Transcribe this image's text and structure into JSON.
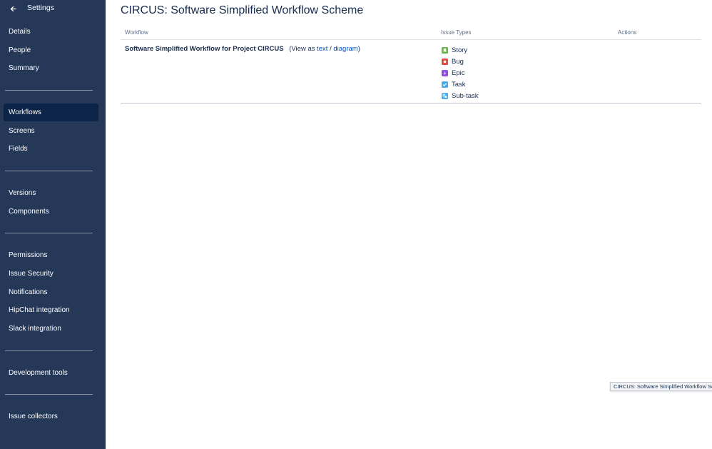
{
  "sidebar": {
    "title": "Settings",
    "back_icon": "arrow-left-icon",
    "groups": [
      [
        "Details",
        "People",
        "Summary"
      ],
      [
        "Workflows",
        "Screens",
        "Fields"
      ],
      [
        "Versions",
        "Components"
      ],
      [
        "Permissions",
        "Issue Security",
        "Notifications",
        "HipChat integration",
        "Slack integration"
      ],
      [
        "Development tools"
      ],
      [
        "Issue collectors"
      ]
    ],
    "active_item": "Workflows"
  },
  "page": {
    "title": "CIRCUS: Software Simplified Workflow Scheme"
  },
  "table": {
    "headers": {
      "workflow": "Workflow",
      "issue_types": "Issue Types",
      "actions": "Actions"
    },
    "row": {
      "workflow_name": "Software Simplified Workflow for Project CIRCUS",
      "view_prefix": "(View as",
      "text_link": "text",
      "separator": "/",
      "diagram_link": "diagram",
      "view_suffix": ")",
      "issue_types": [
        {
          "label": "Story",
          "icon": "story-icon",
          "color": "#63ba3c"
        },
        {
          "label": "Bug",
          "icon": "bug-icon",
          "color": "#e5493a"
        },
        {
          "label": "Epic",
          "icon": "epic-icon",
          "color": "#904ee2"
        },
        {
          "label": "Task",
          "icon": "task-icon",
          "color": "#4bade8"
        },
        {
          "label": "Sub-task",
          "icon": "subtask-icon",
          "color": "#4bade8"
        }
      ]
    }
  },
  "tooltip": {
    "text": "CIRCUS: Software Simplified Workflow Scheme"
  },
  "colors": {
    "sidebar_bg": "#253858",
    "sidebar_active": "#0c2447",
    "link": "#0052cc"
  }
}
